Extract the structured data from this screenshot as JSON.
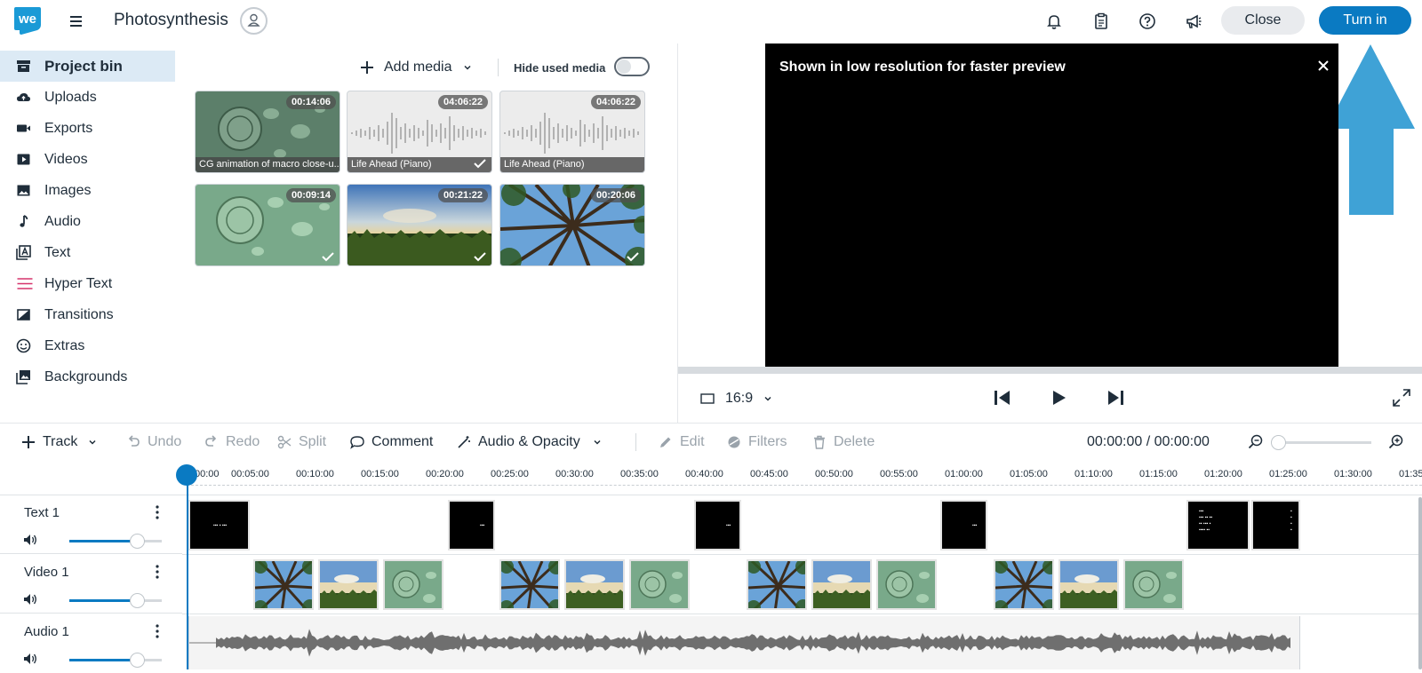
{
  "topbar": {
    "logo_text": "we",
    "project_title": "Photosynthesis",
    "close_label": "Close",
    "turnin_label": "Turn in"
  },
  "sidebar": {
    "items": [
      {
        "label": "Project bin",
        "icon": "archive-icon",
        "active": true
      },
      {
        "label": "Uploads",
        "icon": "cloud-upload-icon"
      },
      {
        "label": "Exports",
        "icon": "video-camera-icon"
      },
      {
        "label": "Videos",
        "icon": "play-square-icon"
      },
      {
        "label": "Images",
        "icon": "image-icon"
      },
      {
        "label": "Audio",
        "icon": "music-note-icon"
      },
      {
        "label": "Text",
        "icon": "text-box-icon"
      },
      {
        "label": "Hyper Text",
        "icon": "hypertext-lines-icon"
      },
      {
        "label": "Transitions",
        "icon": "transition-icon"
      },
      {
        "label": "Extras",
        "icon": "smiley-icon"
      },
      {
        "label": "Backgrounds",
        "icon": "backgrounds-icon"
      }
    ]
  },
  "media": {
    "add_label": "Add media",
    "hide_used_label": "Hide used media",
    "items": [
      {
        "duration": "00:14:06",
        "caption": "CG animation of macro close-u...",
        "kind": "cells"
      },
      {
        "duration": "04:06:22",
        "caption": "Life Ahead (Piano)",
        "kind": "audio"
      },
      {
        "duration": "04:06:22",
        "caption": "Life Ahead (Piano)",
        "kind": "audio"
      },
      {
        "duration": "00:09:14",
        "caption": "",
        "kind": "cells"
      },
      {
        "duration": "00:21:22",
        "caption": "",
        "kind": "field"
      },
      {
        "duration": "00:20:06",
        "caption": "",
        "kind": "trees"
      }
    ]
  },
  "preview": {
    "banner": "Shown in low resolution for faster preview",
    "aspect": "16:9"
  },
  "toolbar": {
    "track": "Track",
    "undo": "Undo",
    "redo": "Redo",
    "split": "Split",
    "comment": "Comment",
    "audio_opacity": "Audio & Opacity",
    "edit": "Edit",
    "filters": "Filters",
    "delete": "Delete",
    "timecode": "00:00:00 / 00:00:00"
  },
  "ruler": [
    "00:00",
    "00:05:00",
    "00:10:00",
    "00:15:00",
    "00:20:00",
    "00:25:00",
    "00:30:00",
    "00:35:00",
    "00:40:00",
    "00:45:00",
    "00:50:00",
    "00:55:00",
    "01:00:00",
    "01:05:00",
    "01:10:00",
    "01:15:00",
    "01:20:00",
    "01:25:00",
    "01:30:00",
    "01:35"
  ],
  "tracks": [
    {
      "name": "Text 1"
    },
    {
      "name": "Video 1"
    },
    {
      "name": "Audio 1"
    }
  ],
  "colors": {
    "accent": "#0a7ac2",
    "arrow": "#3fa2d6"
  }
}
